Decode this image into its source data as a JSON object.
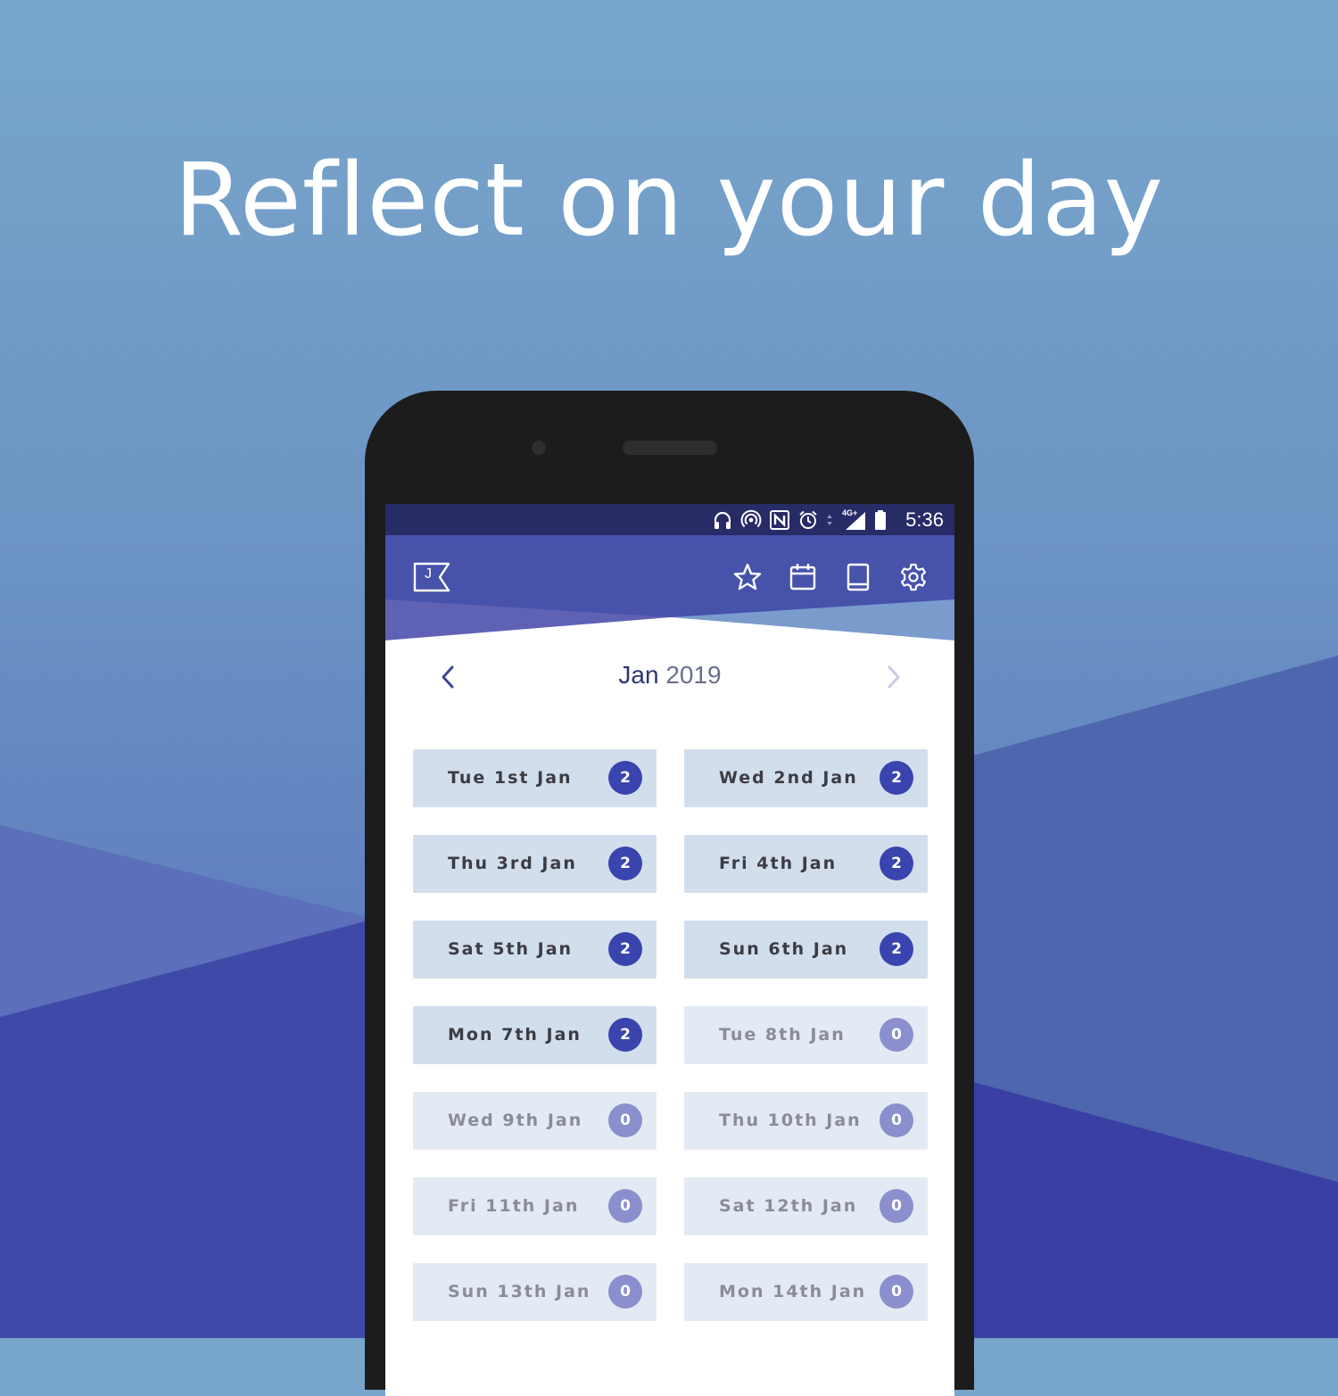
{
  "headline": "Reflect on your day",
  "status_bar": {
    "time": "5:36",
    "network_label": "4G+",
    "icons": [
      "headphones-icon",
      "hotspot-icon",
      "nfc-icon",
      "alarm-icon",
      "data-arrows-icon",
      "signal-icon",
      "battery-icon"
    ]
  },
  "app_bar": {
    "logo_letter": "J",
    "actions": [
      "star-icon",
      "calendar-icon",
      "book-icon",
      "settings-icon"
    ]
  },
  "month_nav": {
    "month": "Jan",
    "year": "2019"
  },
  "days": [
    {
      "label": "Tue 1st Jan",
      "count": "2"
    },
    {
      "label": "Wed 2nd Jan",
      "count": "2"
    },
    {
      "label": "Thu 3rd Jan",
      "count": "2"
    },
    {
      "label": "Fri 4th Jan",
      "count": "2"
    },
    {
      "label": "Sat 5th Jan",
      "count": "2"
    },
    {
      "label": "Sun 6th Jan",
      "count": "2"
    },
    {
      "label": "Mon 7th Jan",
      "count": "2"
    },
    {
      "label": "Tue 8th Jan",
      "count": "0"
    },
    {
      "label": "Wed 9th Jan",
      "count": "0"
    },
    {
      "label": "Thu 10th Jan",
      "count": "0"
    },
    {
      "label": "Fri 11th Jan",
      "count": "0"
    },
    {
      "label": "Sat 12th Jan",
      "count": "0"
    },
    {
      "label": "Sun 13th Jan",
      "count": "0"
    },
    {
      "label": "Mon 14th Jan",
      "count": "0"
    }
  ],
  "colors": {
    "accent": "#3a44ae",
    "status_bar": "#272b66",
    "app_bar": "#4752ab",
    "entry_bg": "#d2deec",
    "empty_bg": "#e3eaf3",
    "empty_badge": "#8b8fcd"
  }
}
